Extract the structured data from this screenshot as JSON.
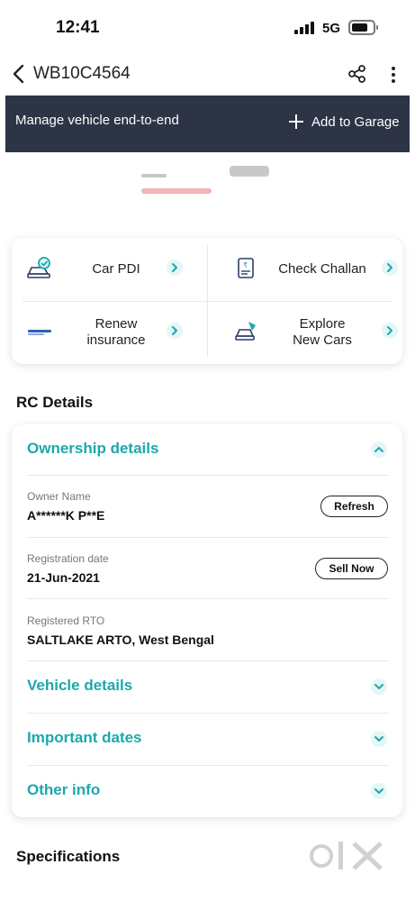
{
  "status_bar": {
    "time": "12:41",
    "network": "5G"
  },
  "header": {
    "vehicle_number": "WB10C4564"
  },
  "banner": {
    "text": "Manage vehicle end-to-end",
    "add_to_garage": "Add to Garage"
  },
  "services": [
    {
      "label": "Car PDI"
    },
    {
      "label": "Check Challan"
    },
    {
      "label": "Renew\ninsurance"
    },
    {
      "label": "Explore\nNew Cars"
    }
  ],
  "rc_details": {
    "title": "RC Details",
    "ownership": {
      "title": "Ownership details",
      "owner_name_label": "Owner Name",
      "owner_name_value": "A******K P**E",
      "refresh_label": "Refresh",
      "registration_date_label": "Registration date",
      "registration_date_value": "21-Jun-2021",
      "sell_now_label": "Sell Now",
      "registered_rto_label": "Registered RTO",
      "registered_rto_value": "SALTLAKE ARTO, West Bengal"
    },
    "sections": [
      {
        "title": "Vehicle details"
      },
      {
        "title": "Important dates"
      },
      {
        "title": "Other info"
      }
    ]
  },
  "specifications": {
    "title": "Specifications"
  },
  "colors": {
    "accent": "#1ca8ac",
    "banner": "#2d3446"
  }
}
